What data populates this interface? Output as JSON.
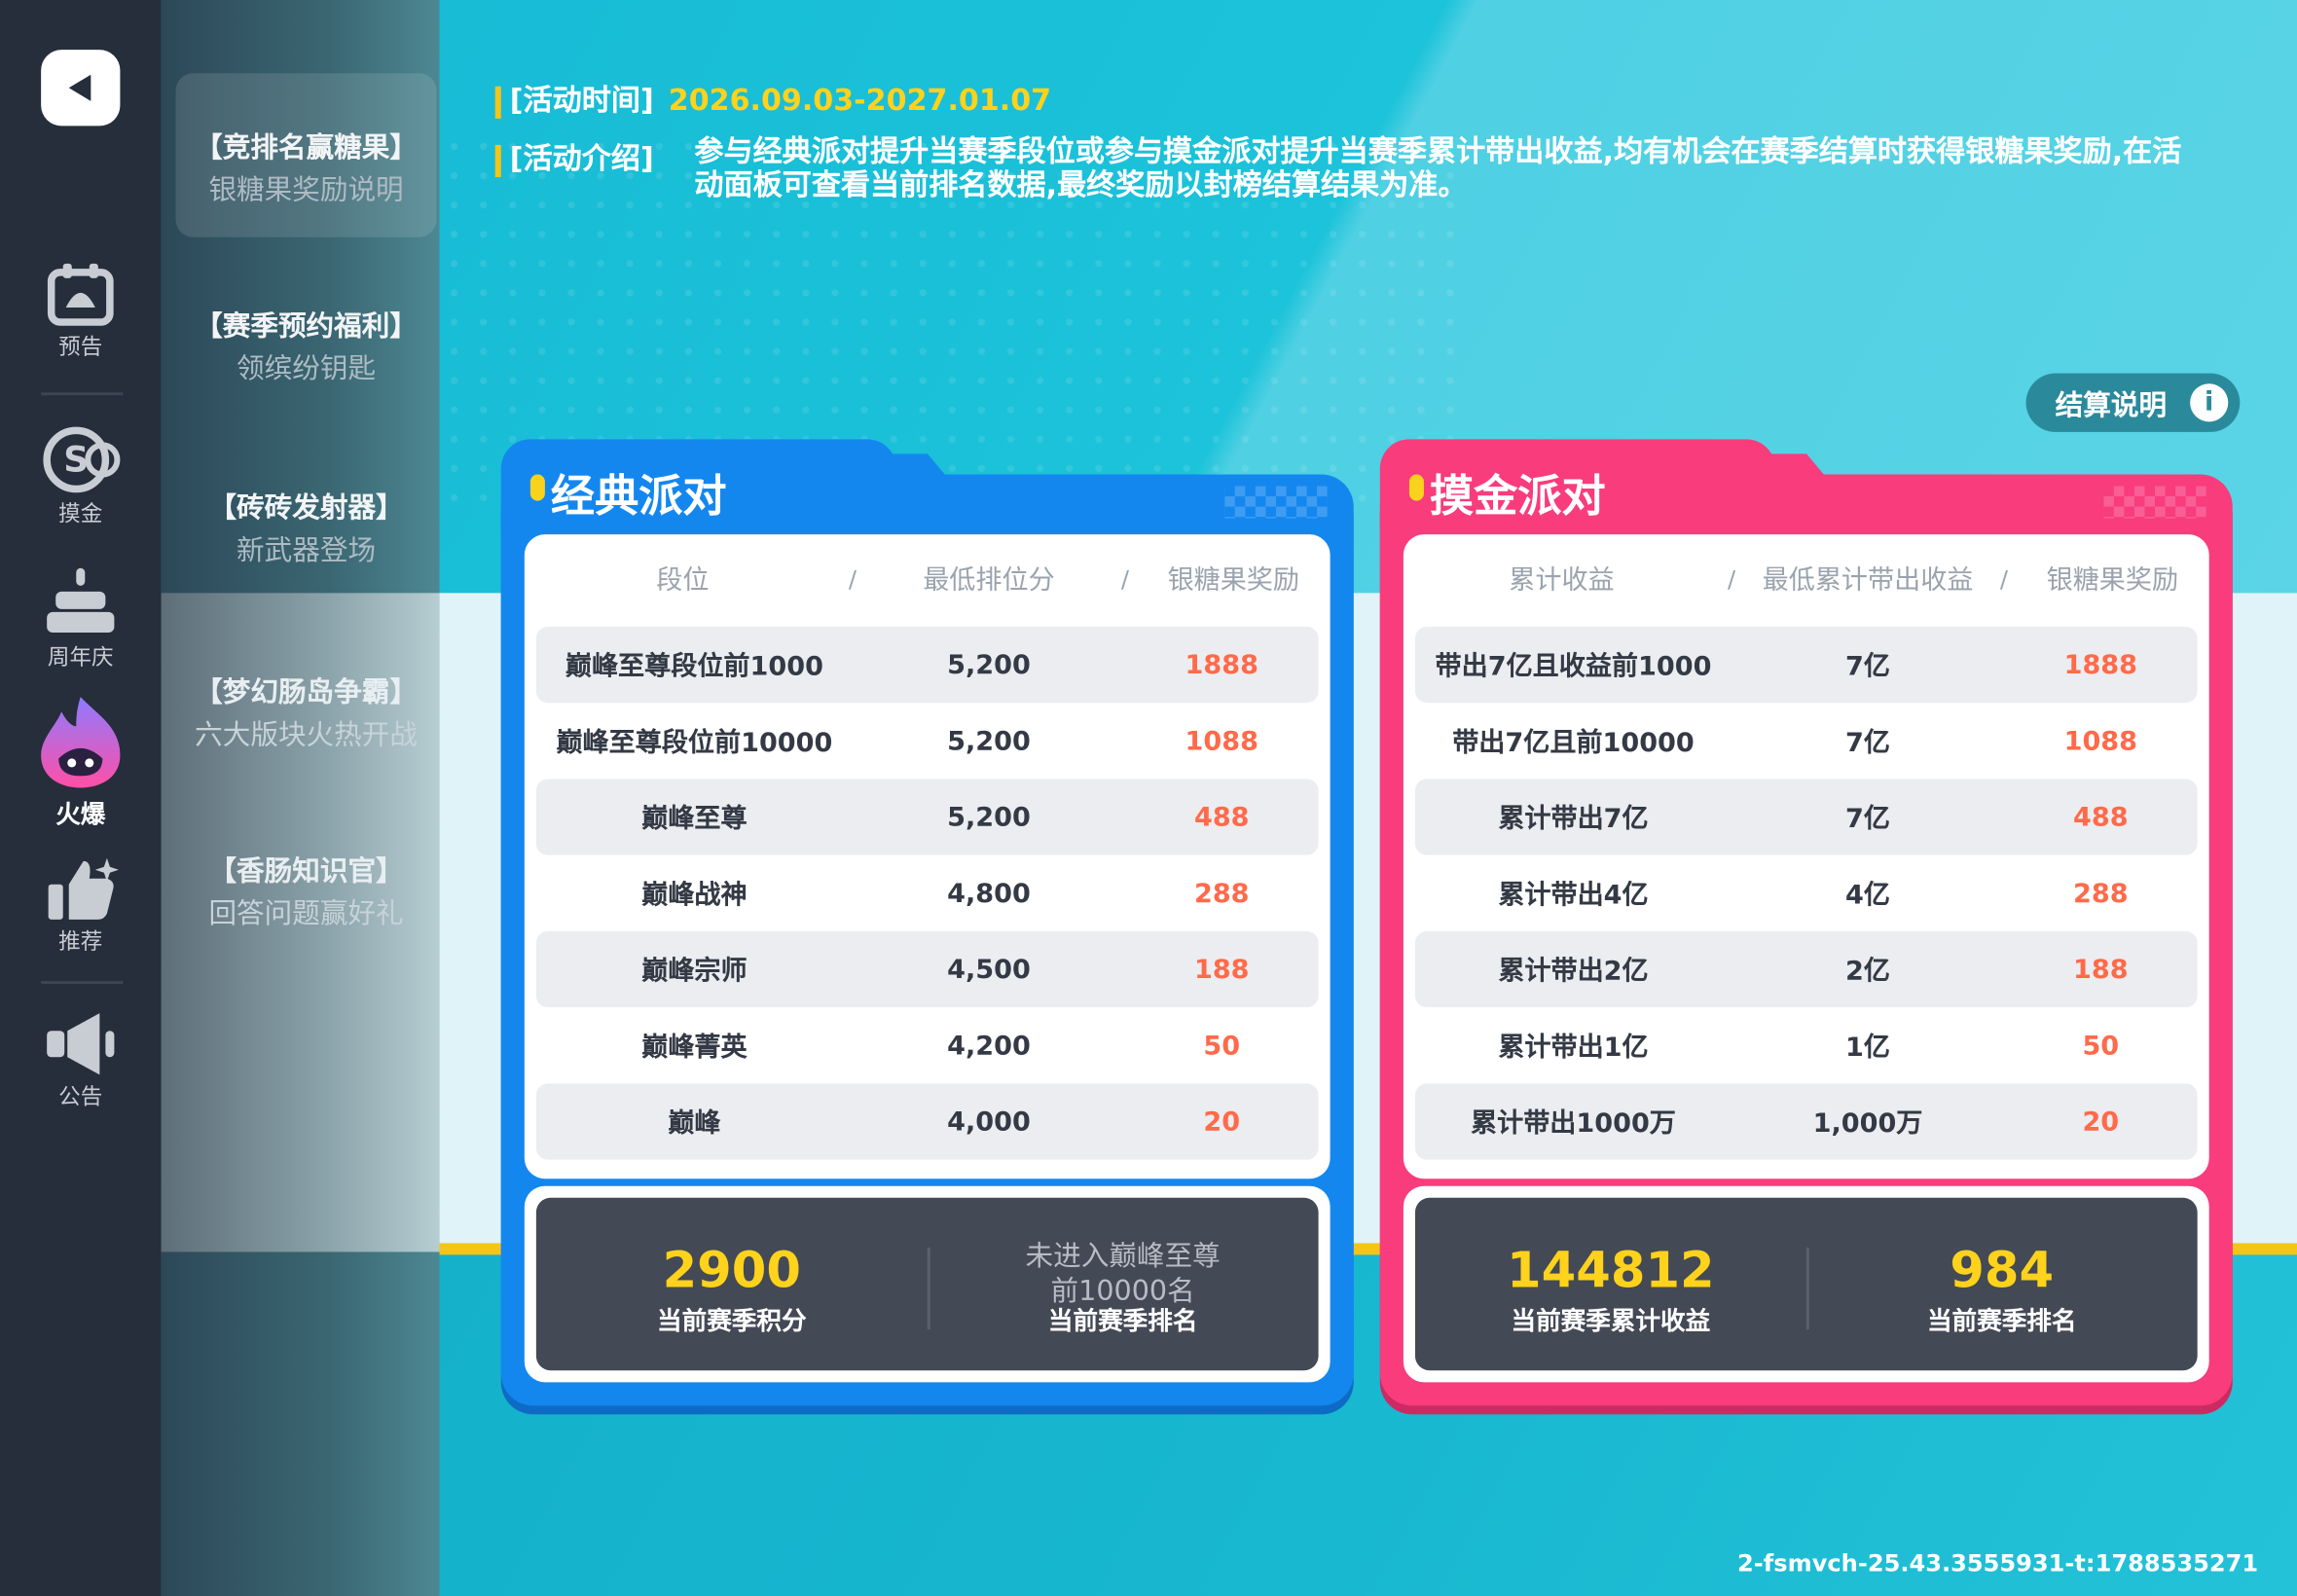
{
  "nav": {
    "items": [
      {
        "label": "预告",
        "icon": "calendar-icon"
      },
      {
        "label": "摸金",
        "icon": "coin-icon"
      },
      {
        "label": "周年庆",
        "icon": "cake-icon"
      },
      {
        "label": "火爆",
        "icon": "flame-mascot-icon"
      },
      {
        "label": "推荐",
        "icon": "thumbs-up-icon"
      },
      {
        "label": "公告",
        "icon": "megaphone-icon"
      }
    ]
  },
  "submenu": [
    {
      "title": "【竞排名赢糖果】",
      "subtitle": "银糖果奖励说明"
    },
    {
      "title": "【赛季预约福利】",
      "subtitle": "领缤纷钥匙"
    },
    {
      "title": "【砖砖发射器】",
      "subtitle": "新武器登场"
    },
    {
      "title": "【梦幻肠岛争霸】",
      "subtitle": "六大版块火热开战"
    },
    {
      "title": "【香肠知识官】",
      "subtitle": "回答问题赢好礼"
    }
  ],
  "info": {
    "time_label": "[活动时间]",
    "time_value": "2026.09.03-2027.01.07",
    "intro_label": "[活动介绍]",
    "intro_text": "参与经典派对提升当赛季段位或参与摸金派对提升当赛季累计带出收益,均有机会在赛季结算时获得银糖果奖励,在活动面板可查看当前排名数据,最终奖励以封榜结算结果为准。"
  },
  "settle_button": "结算说明",
  "classic": {
    "title": "经典派对",
    "headers": [
      "段位",
      "最低排位分",
      "银糖果奖励"
    ],
    "rows": [
      [
        "巅峰至尊段位前1000",
        "5,200",
        "1888"
      ],
      [
        "巅峰至尊段位前10000",
        "5,200",
        "1088"
      ],
      [
        "巅峰至尊",
        "5,200",
        "488"
      ],
      [
        "巅峰战神",
        "4,800",
        "288"
      ],
      [
        "巅峰宗师",
        "4,500",
        "188"
      ],
      [
        "巅峰菁英",
        "4,200",
        "50"
      ],
      [
        "巅峰",
        "4,000",
        "20"
      ]
    ],
    "score_value": "2900",
    "score_label": "当前赛季积分",
    "rank_value_line1": "未进入巅峰至尊",
    "rank_value_line2": "前10000名",
    "rank_label": "当前赛季排名"
  },
  "gold": {
    "title": "摸金派对",
    "headers": [
      "累计收益",
      "最低累计带出收益",
      "银糖果奖励"
    ],
    "rows": [
      [
        "带出7亿且收益前1000",
        "7亿",
        "1888"
      ],
      [
        "带出7亿且前10000",
        "7亿",
        "1088"
      ],
      [
        "累计带出7亿",
        "7亿",
        "488"
      ],
      [
        "累计带出4亿",
        "4亿",
        "288"
      ],
      [
        "累计带出2亿",
        "2亿",
        "188"
      ],
      [
        "累计带出1亿",
        "1亿",
        "50"
      ],
      [
        "累计带出1000万",
        "1,000万",
        "20"
      ]
    ],
    "earn_value": "144812",
    "earn_label": "当前赛季累计收益",
    "rank_value": "984",
    "rank_label": "当前赛季排名"
  },
  "version": "2-fsmvch-25.43.3555931-t:1788535271",
  "colors": {
    "classic": "#1487ef",
    "gold": "#f83c7c",
    "accent": "#ffd21c",
    "reward": "#ff6a4a"
  }
}
